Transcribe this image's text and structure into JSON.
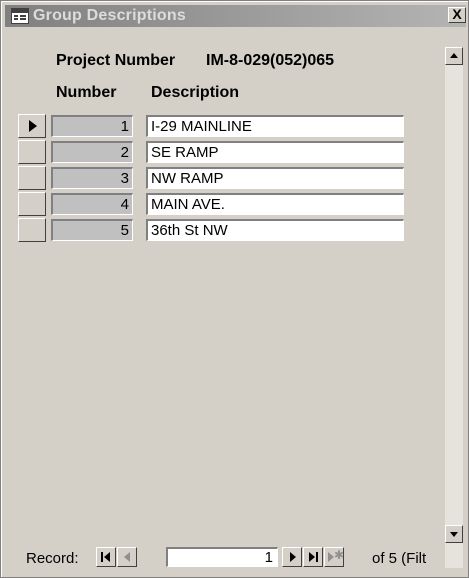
{
  "window": {
    "title": "Group Descriptions",
    "close_label": "X"
  },
  "header": {
    "project_label": "Project Number",
    "project_value": "IM-8-029(052)065"
  },
  "columns": {
    "number": "Number",
    "description": "Description"
  },
  "rows": [
    {
      "number": "1",
      "description": "I-29 MAINLINE"
    },
    {
      "number": "2",
      "description": "SE RAMP"
    },
    {
      "number": "3",
      "description": "NW RAMP"
    },
    {
      "number": "4",
      "description": "MAIN AVE."
    },
    {
      "number": "5",
      "description": "36th St NW"
    }
  ],
  "navigation": {
    "record_label": "Record:",
    "current_record": "1",
    "of_text": "of  5 (Filt"
  },
  "icons": {
    "title": "form-view-icon",
    "first": "first-record-icon",
    "prev": "previous-record-icon",
    "next": "next-record-icon",
    "last": "last-record-icon",
    "new": "new-record-icon",
    "row_selector": "current-record-pointer-icon"
  }
}
